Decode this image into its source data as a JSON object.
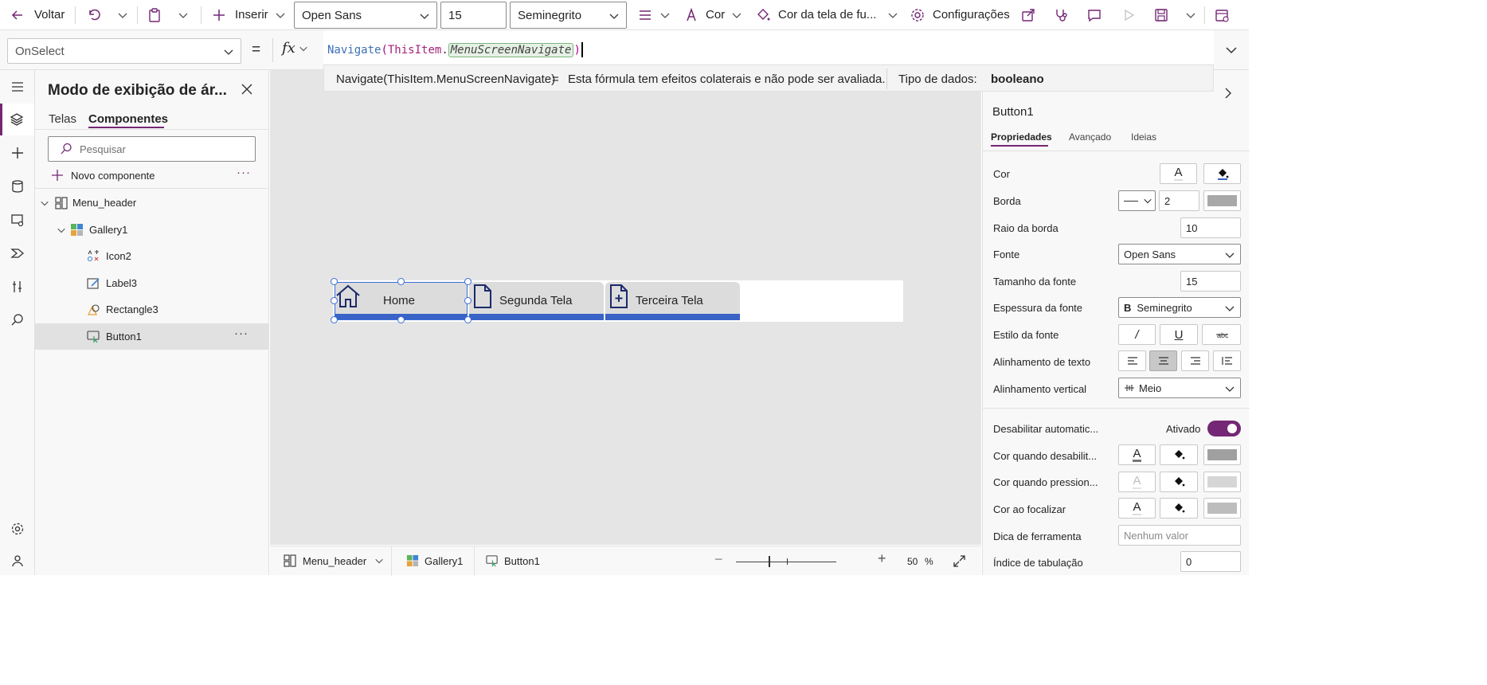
{
  "toolbar": {
    "back_label": "Voltar",
    "insert_label": "Inserir",
    "font_family": "Open Sans",
    "font_size": "15",
    "font_weight": "Seminegrito",
    "color_label": "Cor",
    "screen_color_label": "Cor da tela de fu...",
    "settings_label": "Configurações"
  },
  "formula_bar": {
    "property": "OnSelect",
    "equals": "=",
    "fx": "fx",
    "formula_func": "Navigate",
    "formula_open": "(",
    "formula_obj": "ThisItem",
    "formula_dot": ".",
    "formula_field": "MenuScreenNavigate",
    "formula_close": ")",
    "hint_expression": "Navigate(ThisItem.MenuScreenNavigate)",
    "hint_equals": "=",
    "hint_message": "Esta fórmula tem efeitos colaterais e não pode ser avaliada.",
    "datatype_label": "Tipo de dados:",
    "datatype_value": "booleano"
  },
  "tree_panel": {
    "title": "Modo de exibição de ár...",
    "tabs": [
      "Telas",
      "Componentes"
    ],
    "active_tab": "Componentes",
    "search_placeholder": "Pesquisar",
    "new_component_label": "Novo componente",
    "items": [
      {
        "label": "Menu_header",
        "level": 0,
        "icon": "component-icon"
      },
      {
        "label": "Gallery1",
        "level": 1,
        "icon": "gallery-icon"
      },
      {
        "label": "Icon2",
        "level": 2,
        "icon": "icon-control-icon"
      },
      {
        "label": "Label3",
        "level": 2,
        "icon": "label-icon"
      },
      {
        "label": "Rectangle3",
        "level": 2,
        "icon": "shape-icon"
      },
      {
        "label": "Button1",
        "level": 2,
        "icon": "button-icon",
        "selected": true
      }
    ]
  },
  "canvas": {
    "menu_items": [
      {
        "label": "Home",
        "icon": "home-icon"
      },
      {
        "label": "Segunda Tela",
        "icon": "document-icon"
      },
      {
        "label": "Terceira Tela",
        "icon": "add-document-icon"
      }
    ]
  },
  "statusbar": {
    "breadcrumb": [
      "Menu_header",
      "Gallery1",
      "Button1"
    ],
    "zoom_value": "50",
    "zoom_unit": "%"
  },
  "properties": {
    "control_name": "Button1",
    "tabs": [
      "Propriedades",
      "Avançado",
      "Ideias"
    ],
    "active_tab": "Propriedades",
    "rows": {
      "cor": "Cor",
      "borda": "Borda",
      "borda_value": "2",
      "raio": "Raio da borda",
      "raio_value": "10",
      "fonte": "Fonte",
      "fonte_value": "Open Sans",
      "tamanho": "Tamanho da fonte",
      "tamanho_value": "15",
      "espessura": "Espessura da fonte",
      "espessura_value": "Seminegrito",
      "espessura_glyph": "B",
      "estilo": "Estilo da fonte",
      "estilo_italic": "/",
      "estilo_underline": "U",
      "alinhamento": "Alinhamento de texto",
      "vertical": "Alinhamento vertical",
      "vertical_value": "Meio",
      "desabilitar": "Desabilitar automatic...",
      "desabilitar_value": "Ativado",
      "cor_desab": "Cor quando desabilit...",
      "cor_press": "Cor quando pression...",
      "cor_foco": "Cor ao focalizar",
      "dica": "Dica de ferramenta",
      "dica_placeholder": "Nenhum valor",
      "indice": "Índice de tabulação",
      "indice_value": "0",
      "font_color_glyph": "A"
    }
  },
  "colors": {
    "accent": "#742774",
    "canvas": "#e5e5e5",
    "bar": "#3a63c7",
    "menu_button": "#dcdcdc",
    "icon_navy": "#1b2a6b",
    "handles": "#3a6dd8"
  }
}
